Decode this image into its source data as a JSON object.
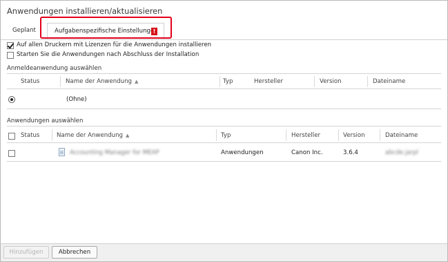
{
  "window": {
    "title": "Anwendungen installieren/aktualisieren"
  },
  "tabs": {
    "geplant": "Geplant",
    "aufgaben": "Aufgabenspezifische Einstellungen",
    "aufgaben_badge": "!"
  },
  "options": {
    "install_all": {
      "label": "Auf allen Druckern mit Lizenzen für die Anwendungen installieren",
      "checked": true
    },
    "start_after": {
      "label": "Starten Sie die Anwendungen nach Abschluss der Installation",
      "checked": false
    }
  },
  "login_app": {
    "section_label": "Anmeldeanwendung auswählen",
    "columns": {
      "status": "Status",
      "name": "Name der Anwendung",
      "typ": "Typ",
      "hersteller": "Hersteller",
      "version": "Version",
      "dateiname": "Dateiname"
    },
    "rows": [
      {
        "name": "(Ohne)",
        "selected": true
      }
    ]
  },
  "apps": {
    "section_label": "Anwendungen auswählen",
    "columns": {
      "status": "Status",
      "name": "Name der Anwendung",
      "typ": "Typ",
      "hersteller": "Hersteller",
      "version": "Version",
      "dateiname": "Dateiname"
    },
    "rows": [
      {
        "name": "Accounting Manager for MEAP",
        "typ": "Anwendungen",
        "hersteller": "Canon Inc.",
        "version": "3.6.4",
        "dateiname": "abcde.jarpl"
      }
    ]
  },
  "footer": {
    "add_button": "Hinzufügen",
    "cancel_button": "Abbrechen"
  }
}
